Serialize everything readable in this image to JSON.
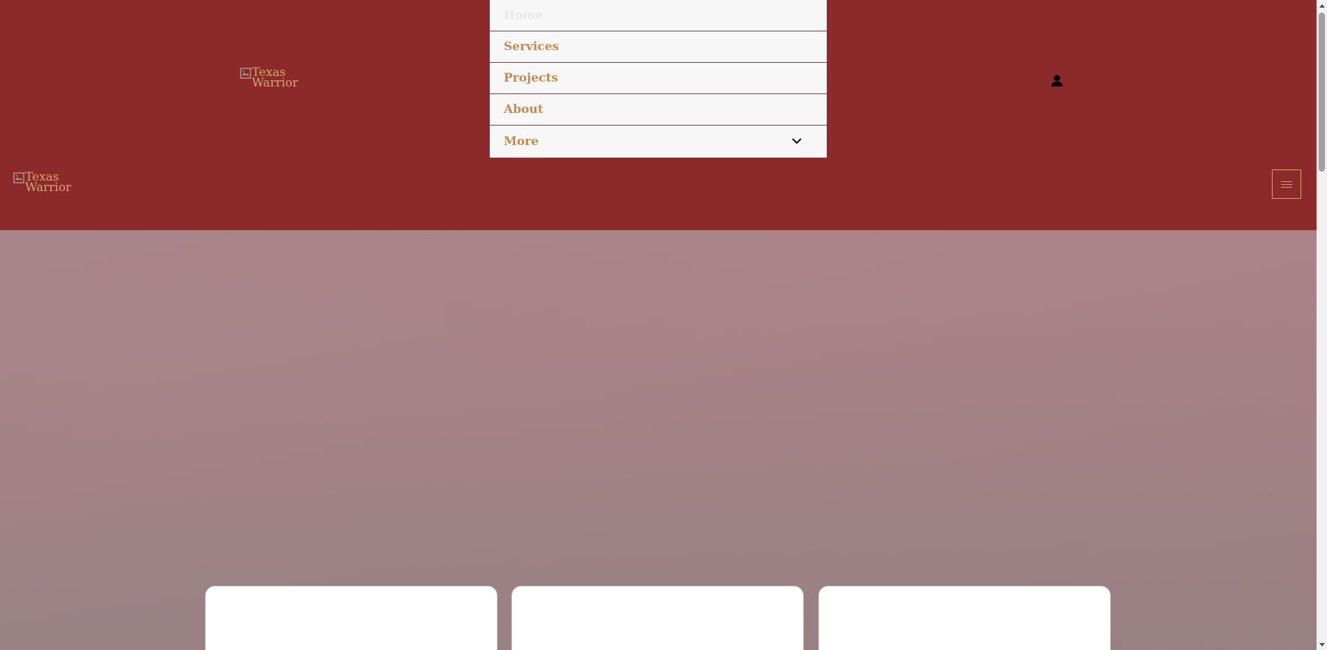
{
  "header": {
    "logo_alt": "Texas Warrior",
    "logo_line1": "Texas",
    "logo_line2": "Warrior"
  },
  "nav": {
    "items": [
      {
        "label": "Home"
      },
      {
        "label": "Services"
      },
      {
        "label": "Projects"
      },
      {
        "label": "About"
      },
      {
        "label": "More"
      }
    ]
  },
  "icons": {
    "account": "user-icon",
    "menu": "hamburger-menu-icon",
    "more": "chevron-down-icon"
  },
  "colors": {
    "brand": "#8c2a2b",
    "accent": "#d4a86a",
    "nav_text": "#c48a52",
    "nav_bg": "#f7f7f7"
  }
}
